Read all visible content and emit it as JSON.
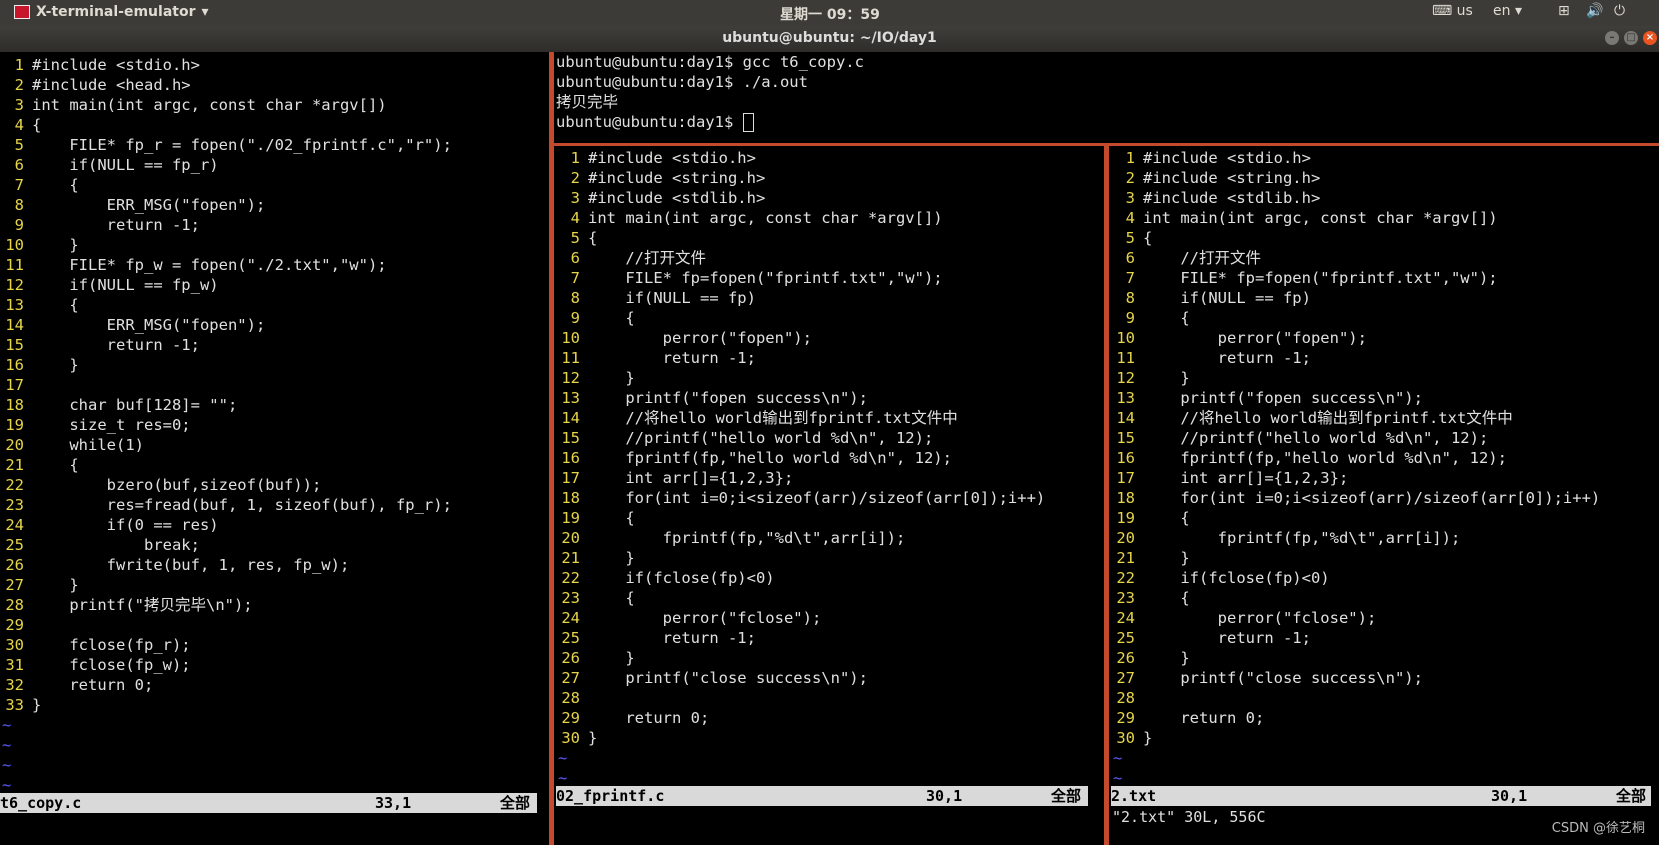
{
  "topbar": {
    "app_name": "X-terminal-emulator",
    "clock": "星期一 09：59",
    "kbd": "us",
    "lang": "en"
  },
  "window": {
    "title": "ubuntu@ubuntu: ~/IO/day1"
  },
  "left_pane": {
    "lines": [
      "#include <stdio.h>",
      "#include <head.h>",
      "int main(int argc, const char *argv[])",
      "{",
      "    FILE* fp_r = fopen(\"./02_fprintf.c\",\"r\");",
      "    if(NULL == fp_r)",
      "    {",
      "        ERR_MSG(\"fopen\");",
      "        return -1;",
      "    }",
      "    FILE* fp_w = fopen(\"./2.txt\",\"w\");",
      "    if(NULL == fp_w)",
      "    {",
      "        ERR_MSG(\"fopen\");",
      "        return -1;",
      "    }",
      "",
      "    char buf[128]= \"\";",
      "    size_t res=0;",
      "    while(1)",
      "    {",
      "        bzero(buf,sizeof(buf));",
      "        res=fread(buf, 1, sizeof(buf), fp_r);",
      "        if(0 == res)",
      "            break;",
      "        fwrite(buf, 1, res, fp_w);",
      "    }",
      "    printf(\"拷贝完毕\\n\");",
      "",
      "    fclose(fp_r);",
      "    fclose(fp_w);",
      "    return 0;",
      "}"
    ],
    "status_file": "t6_copy.c",
    "status_pos": "33,1",
    "status_all": "全部"
  },
  "terminal": {
    "lines": [
      "ubuntu@ubuntu:day1$ gcc t6_copy.c",
      "ubuntu@ubuntu:day1$ ./a.out",
      "拷贝完毕",
      "ubuntu@ubuntu:day1$ "
    ]
  },
  "mid_pane": {
    "lines": [
      "#include <stdio.h>",
      "#include <string.h>",
      "#include <stdlib.h>",
      "int main(int argc, const char *argv[])",
      "{",
      "    //打开文件",
      "    FILE* fp=fopen(\"fprintf.txt\",\"w\");",
      "    if(NULL == fp)",
      "    {",
      "        perror(\"fopen\");",
      "        return -1;",
      "    }",
      "    printf(\"fopen success\\n\");",
      "    //将hello world输出到fprintf.txt文件中",
      "    //printf(\"hello world %d\\n\", 12);",
      "    fprintf(fp,\"hello world %d\\n\", 12);",
      "    int arr[]={1,2,3};",
      "    for(int i=0;i<sizeof(arr)/sizeof(arr[0]);i++)",
      "    {",
      "        fprintf(fp,\"%d\\t\",arr[i]);",
      "    }",
      "    if(fclose(fp)<0)",
      "    {",
      "        perror(\"fclose\");",
      "        return -1;",
      "    }",
      "    printf(\"close success\\n\");",
      "",
      "    return 0;",
      "}"
    ],
    "status_file": "02_fprintf.c",
    "status_pos": "30,1",
    "status_all": "全部"
  },
  "right_pane": {
    "status_file": "2.txt",
    "status_pos": "30,1",
    "status_all": "全部",
    "message": "\"2.txt\" 30L, 556C"
  },
  "watermark": "CSDN @徐艺桐"
}
